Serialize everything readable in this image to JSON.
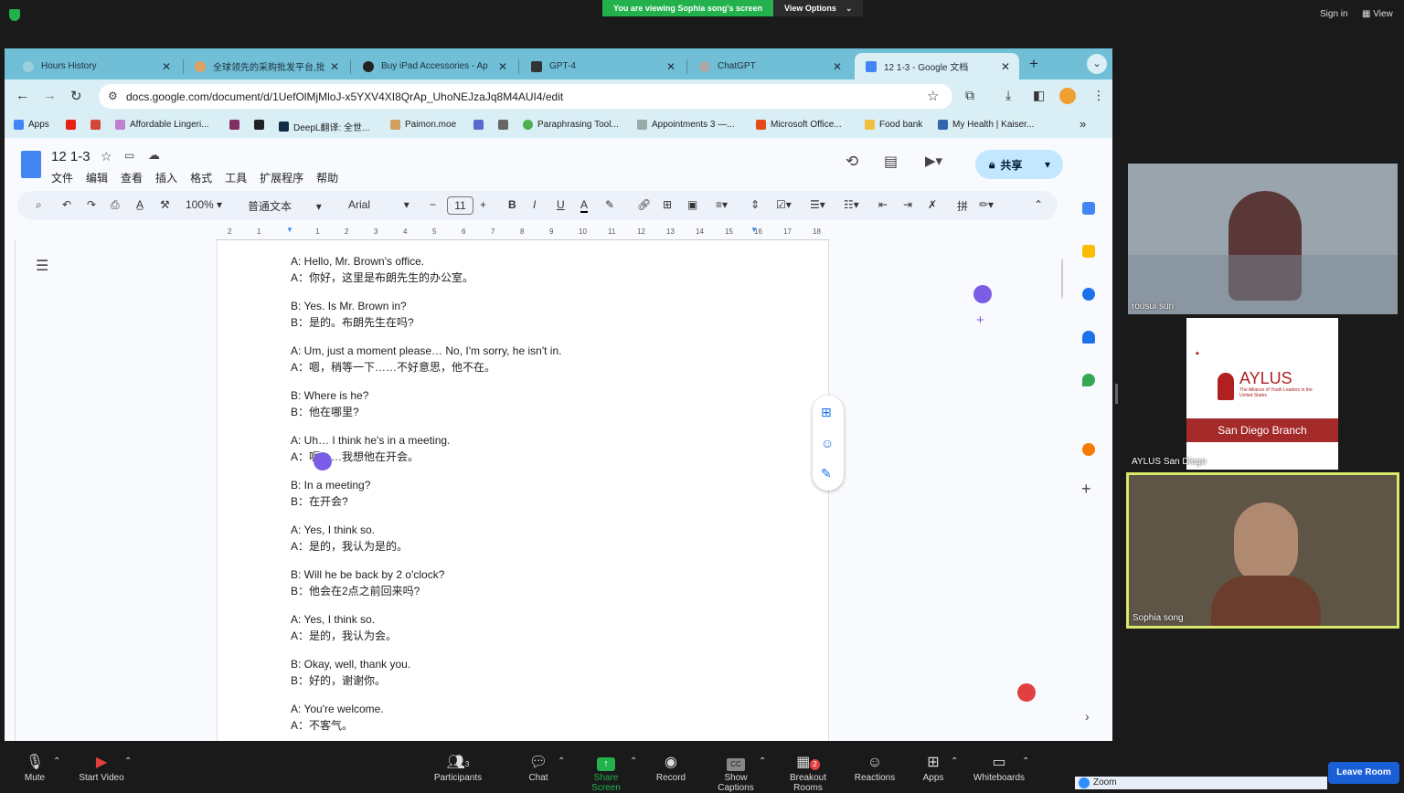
{
  "zoom": {
    "banner_text": "You are viewing Sophia song's screen",
    "view_options": "View Options",
    "sign_in": "Sign in",
    "view": "View",
    "participant_count": "3",
    "breakout_badge": "2",
    "bottom_buttons": [
      "Mute",
      "Start Video",
      "Participants",
      "Chat",
      "Share Screen",
      "Record",
      "Show Captions",
      "Breakout Rooms",
      "Reactions",
      "Apps",
      "Whiteboards"
    ],
    "leave": "Leave Room",
    "zoom_label": "Zoom",
    "tiles": [
      {
        "name": "rousui sun"
      },
      {
        "name": "AYLUS San Diego",
        "logo_text": "AYLUS",
        "logo_sub": "The Alliance of Youth Leaders in the United States",
        "branch": "San Diego Branch"
      },
      {
        "name": "Sophia song"
      }
    ]
  },
  "browser": {
    "tabs": [
      {
        "label": "Hours History",
        "fav_color": "#9ad0e0"
      },
      {
        "label": "全球领先的采购批发平台,批",
        "fav_color": "#e0a060"
      },
      {
        "label": "Buy iPad Accessories - Ap",
        "fav_color": "#222222"
      },
      {
        "label": "GPT-4",
        "fav_color": "#333333"
      },
      {
        "label": "ChatGPT",
        "fav_color": "#aaaaaa"
      },
      {
        "label": "12 1-3 - Google 文档",
        "fav_color": "#4285f4"
      }
    ],
    "url": "docs.google.com/document/d/1UefOlMjMloJ-x5YXV4XI8QrAp_UhoNEJzaJq8M4AUI4/edit",
    "bookmarks": [
      "Apps",
      "Affordable Lingeri...",
      "DeepL翻译: 全世...",
      "Paimon.moe",
      "Paraphrasing Tool...",
      "Appointments 3 —...",
      "Microsoft Office...",
      "Food bank",
      "My Health | Kaiser..."
    ]
  },
  "doc": {
    "title": "12 1-3",
    "menu": [
      "文件",
      "编辑",
      "查看",
      "插入",
      "格式",
      "工具",
      "扩展程序",
      "帮助"
    ],
    "share_label": "共享",
    "zoom": "100%",
    "style": "普通文本",
    "font": "Arial",
    "font_size": "11",
    "ruler_labels": [
      "2",
      "1",
      "1",
      "2",
      "3",
      "4",
      "5",
      "6",
      "7",
      "8",
      "9",
      "10",
      "11",
      "12",
      "13",
      "14",
      "15",
      "16",
      "17",
      "18"
    ],
    "lines": [
      "A: Hello, Mr. Brown's office.",
      "A：你好，这里是布朗先生的办公室。",
      "B: Yes. Is Mr. Brown in?",
      "B：是的。布朗先生在吗?",
      "A: Um, just a moment please… No, I'm sorry, he isn't in.",
      "A：嗯，稍等一下……不好意思，他不在。",
      "B: Where is he?",
      "B：他在哪里?",
      "A: Uh… I think he's in a meeting.",
      "A：呃……我想他在开会。",
      "B: In a meeting?",
      "B：在开会?",
      "A: Yes, I think so.",
      "A：是的，我认为是的。",
      "B: Will he be back by 2 o'clock?",
      "B：他会在2点之前回来吗?",
      "A: Yes, I think so.",
      "A：是的，我认为会。",
      "B: Okay, well, thank you.",
      "B：好的，谢谢你。",
      "A: You're welcome.",
      "A：不客气。"
    ]
  }
}
